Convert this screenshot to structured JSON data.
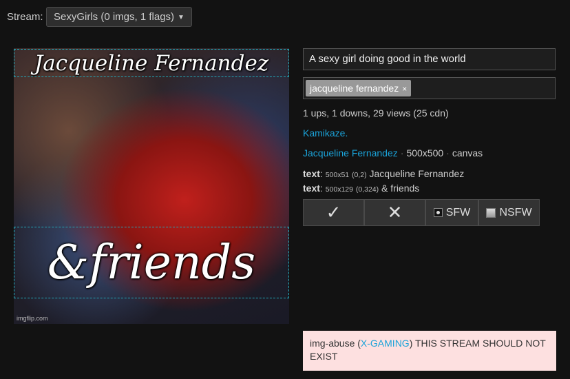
{
  "stream": {
    "label": "Stream:",
    "selected": "SexyGirls (0 imgs, 1 flags)"
  },
  "image": {
    "captions": [
      "Jacqueline Fernandez",
      "&friends"
    ],
    "watermark": "imgflip.com"
  },
  "form": {
    "title_value": "A sexy girl doing good in the world",
    "tags": [
      {
        "label": "jacqueline fernandez",
        "remove": "×"
      }
    ]
  },
  "stats": "1 ups, 1 downs, 29 views (25 cdn)",
  "user": "Kamikaze.",
  "meta": {
    "template": "Jacqueline Fernandez",
    "dimensions": "500x500",
    "type": "canvas",
    "separator": "·"
  },
  "layers": [
    {
      "kind": "text",
      "sep": ":",
      "size": "500x51",
      "pos": "(0,2)",
      "content": "Jacqueline Fernandez"
    },
    {
      "kind": "text",
      "sep": ":",
      "size": "500x129",
      "pos": "(0,324)",
      "content": "& friends"
    }
  ],
  "actions": {
    "approve": "✓",
    "reject": "✕",
    "sfw": "SFW",
    "nsfw": "NSFW"
  },
  "flag": {
    "prefix": "img-abuse (",
    "user": "X-GAMING",
    "suffix": ") THIS STREAM SHOULD NOT EXIST"
  },
  "colors": {
    "link": "#1aa3d9",
    "flag_bg": "#fde0e0",
    "bg": "#121212"
  }
}
